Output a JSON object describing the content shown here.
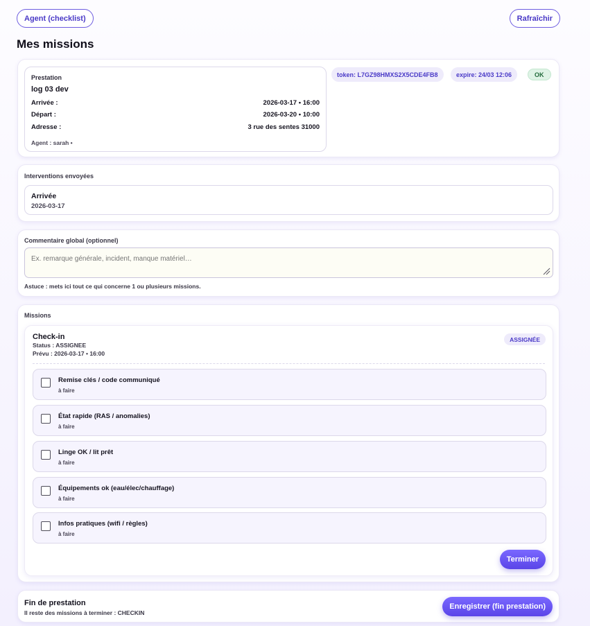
{
  "header": {
    "agent_button": "Agent (checklist)",
    "refresh_button": "Rafraîchir",
    "page_title": "Mes missions"
  },
  "prestation": {
    "label": "Prestation",
    "name": "log 03 dev",
    "arrival_label": "Arrivée :",
    "arrival_value": "2026-03-17 • 16:00",
    "departure_label": "Départ :",
    "departure_value": "2026-03-20 • 10:00",
    "address_label": "Adresse :",
    "address_value": "3 rue des sentes 31000",
    "agent_text": "Agent : sarah •",
    "token": "token: L7GZ98HMXS2X5CDE4FB8",
    "expire": "expire: 24/03 12:06",
    "status": "OK"
  },
  "interventions": {
    "label": "Interventions envoyées",
    "items": [
      {
        "title": "Arrivée",
        "date": "2026-03-17"
      }
    ]
  },
  "comment": {
    "label": "Commentaire global (optionnel)",
    "placeholder": "Ex. remarque générale, incident, manque matériel…",
    "hint": "Astuce : mets ici tout ce qui concerne 1 ou plusieurs missions."
  },
  "missions": {
    "label": "Missions",
    "mission": {
      "title": "Check-in",
      "status_text": "Status : ASSIGNEE",
      "planned_text": "Prévu : 2026-03-17 • 16:00",
      "badge": "ASSIGNÉE",
      "tasks": [
        {
          "title": "Remise clés / code communiqué",
          "state": "à faire",
          "checked": false
        },
        {
          "title": "État rapide (RAS / anomalies)",
          "state": "à faire",
          "checked": false
        },
        {
          "title": "Linge OK / lit prêt",
          "state": "à faire",
          "checked": false
        },
        {
          "title": "Équipements ok (eau/élec/chauffage)",
          "state": "à faire",
          "checked": false
        },
        {
          "title": "Infos pratiques (wifi / règles)",
          "state": "à faire",
          "checked": false
        }
      ],
      "finish_button": "Terminer"
    }
  },
  "footer": {
    "title": "Fin de prestation",
    "subtitle": "Il reste des missions à terminer : CHECKIN",
    "save_button": "Enregistrer (fin prestation)"
  },
  "colors": {
    "accent": "#5a45e8",
    "accent_light": "#eeebfb",
    "ok_green": "#236b3c"
  }
}
